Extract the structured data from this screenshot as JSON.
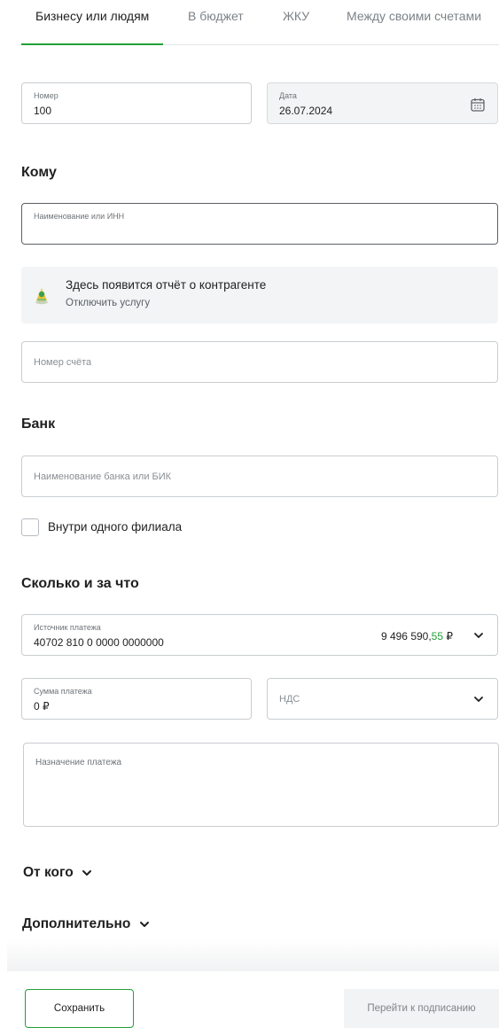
{
  "tabs": [
    {
      "label": "Бизнесу или людям",
      "active": true
    },
    {
      "label": "В бюджет",
      "active": false
    },
    {
      "label": "ЖКУ",
      "active": false
    },
    {
      "label": "Между своими счетами",
      "active": false
    }
  ],
  "document": {
    "number": {
      "label": "Номер",
      "value": "100"
    },
    "date": {
      "label": "Дата",
      "value": "26.07.2024",
      "icon": "calendar-icon"
    }
  },
  "recipient": {
    "title": "Кому",
    "name_inn_label": "Наименование или ИНН",
    "info": {
      "icon": "counterparty-report-icon",
      "title": "Здесь появится отчёт о контрагенте",
      "link": "Отключить услугу"
    },
    "account_placeholder": "Номер счёта"
  },
  "bank": {
    "title": "Банк",
    "placeholder": "Наименование банка или БИК",
    "same_branch_label": "Внутри одного филиала",
    "same_branch_checked": false
  },
  "payment": {
    "title": "Сколько и за что",
    "source": {
      "label": "Источник платежа",
      "value": "40702 810 0 0000 0000000",
      "balance_main": "9 496 590,",
      "balance_kop": "55",
      "balance_currency": " ₽"
    },
    "sum": {
      "label": "Сумма платежа",
      "value": "0 ₽"
    },
    "vat": {
      "placeholder": "НДС"
    },
    "purpose_label": "Назначение платежа"
  },
  "sections": {
    "from": "От кого",
    "additional": "Дополнительно"
  },
  "actions": {
    "save": "Сохранить",
    "sign": "Перейти к подписанию"
  },
  "colors": {
    "accent": "#21a038"
  }
}
